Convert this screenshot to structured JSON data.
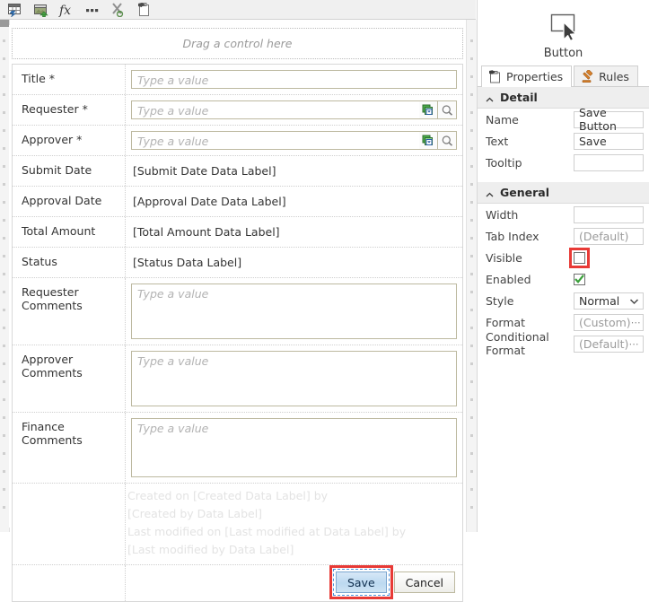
{
  "toolbar": {
    "icons": [
      {
        "name": "insert-table-icon",
        "title": "Insert Table"
      },
      {
        "name": "insert-image-icon",
        "title": "Insert Image"
      },
      {
        "name": "formula-icon",
        "title": "Formula"
      },
      {
        "name": "more-options-icon",
        "title": "More"
      },
      {
        "name": "cut-paste-icon",
        "title": "Cut"
      },
      {
        "name": "paste-control-icon",
        "title": "Paste"
      }
    ]
  },
  "canvas": {
    "dropzone_text": "Drag a control here",
    "placeholder": "Type a value",
    "rows": [
      {
        "label": "Title *",
        "type": "text",
        "value": "",
        "placeholder": "Type a value",
        "lookup": false
      },
      {
        "label": "Requester *",
        "type": "text",
        "value": "",
        "placeholder": "Type a value",
        "lookup": true
      },
      {
        "label": "Approver *",
        "type": "text",
        "value": "",
        "placeholder": "Type a value",
        "lookup": true
      },
      {
        "label": "Submit Date",
        "type": "label",
        "value": "[Submit Date Data Label]"
      },
      {
        "label": "Approval Date",
        "type": "label",
        "value": "[Approval Date Data Label]"
      },
      {
        "label": "Total Amount",
        "type": "label",
        "value": "[Total Amount Data Label]"
      },
      {
        "label": "Status",
        "type": "label",
        "value": "[Status Data Label]"
      },
      {
        "label": "Requester Comments",
        "type": "textarea",
        "value": "",
        "placeholder": "Type a value"
      },
      {
        "label": "Approver Comments",
        "type": "textarea",
        "value": "",
        "placeholder": "Type a value"
      },
      {
        "label": "Finance Comments",
        "type": "textarea",
        "value": "",
        "placeholder": "Type a value"
      }
    ],
    "meta_lines": [
      "Created on  [Created Data Label]  by",
      "[Created by Data Label]",
      "Last modified on  [Last modified at Data Label]  by",
      "[Last modified by Data Label]"
    ],
    "buttons": {
      "save_label": "Save",
      "cancel_label": "Cancel"
    }
  },
  "panel": {
    "control_icon": "button-control-icon",
    "control_type": "Button",
    "tabs": [
      {
        "label": "Properties",
        "icon": "properties-clipboard-icon",
        "active": true
      },
      {
        "label": "Rules",
        "icon": "rules-gavel-icon",
        "active": false
      }
    ],
    "sections": [
      {
        "title": "Detail",
        "collapsed": false,
        "rows": [
          {
            "label": "Name",
            "kind": "text",
            "value": "Save Button"
          },
          {
            "label": "Text",
            "kind": "text",
            "value": "Save"
          },
          {
            "label": "Tooltip",
            "kind": "text",
            "value": ""
          }
        ]
      },
      {
        "title": "General",
        "collapsed": false,
        "rows": [
          {
            "label": "Width",
            "kind": "text",
            "value": ""
          },
          {
            "label": "Tab Index",
            "kind": "text",
            "value": "(Default)",
            "muted": true
          },
          {
            "label": "Visible",
            "kind": "checkbox",
            "checked": false,
            "highlight": true
          },
          {
            "label": "Enabled",
            "kind": "checkbox",
            "checked": true,
            "highlight": false
          },
          {
            "label": "Style",
            "kind": "select",
            "value": "Normal"
          },
          {
            "label": "Format",
            "kind": "ellipsis",
            "value": "(Custom)",
            "muted": true
          },
          {
            "label": "Conditional Format",
            "kind": "ellipsis",
            "value": "(Default)",
            "muted": true
          }
        ]
      }
    ]
  },
  "colors": {
    "highlight_red": "#e83a36",
    "selection_blue": "#4a90d9",
    "check_green": "#3aa03a",
    "panel_section_bg": "#eeeeee"
  }
}
